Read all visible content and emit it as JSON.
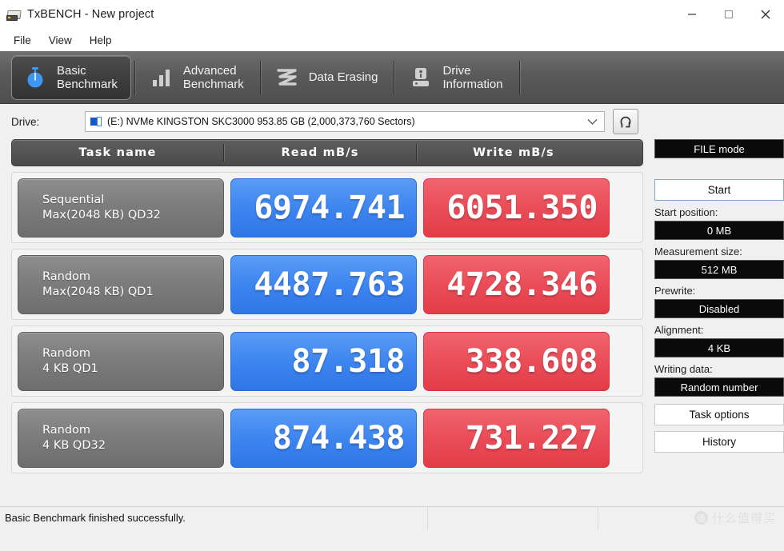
{
  "window": {
    "title": "TxBENCH - New project",
    "app_icon": "drive-icon",
    "minimize": "minimize-icon",
    "maximize": "maximize-icon",
    "close": "close-icon"
  },
  "menu": {
    "items": [
      {
        "label": "File"
      },
      {
        "label": "View"
      },
      {
        "label": "Help"
      }
    ]
  },
  "tabs": [
    {
      "label": "Basic\nBenchmark",
      "icon": "stopwatch-icon",
      "active": true
    },
    {
      "label": "Advanced\nBenchmark",
      "icon": "bar-chart-icon",
      "active": false
    },
    {
      "label": "Data Erasing",
      "icon": "eraser-wave-icon",
      "active": false
    },
    {
      "label": "Drive\nInformation",
      "icon": "drive-info-icon",
      "active": false
    }
  ],
  "drive": {
    "label": "Drive:",
    "value": "(E:) NVMe KINGSTON SKC3000  953.85 GB (2,000,373,760 Sectors)",
    "icon": "drive-icon",
    "dropdown_icon": "chevron-down-icon",
    "refresh_icon": "refresh-icon"
  },
  "table": {
    "headers": [
      "Task name",
      "Read mB/s",
      "Write mB/s"
    ],
    "rows": [
      {
        "task_line1": "Sequential",
        "task_line2": "Max(2048 KB) QD32",
        "read": "6974.741",
        "write": "6051.350"
      },
      {
        "task_line1": "Random",
        "task_line2": "Max(2048 KB) QD1",
        "read": "4487.763",
        "write": "4728.346"
      },
      {
        "task_line1": "Random",
        "task_line2": "4 KB QD1",
        "read": "87.318",
        "write": "338.608"
      },
      {
        "task_line1": "Random",
        "task_line2": "4 KB QD32",
        "read": "874.438",
        "write": "731.227"
      }
    ]
  },
  "sidebar": {
    "mode_button": "FILE mode",
    "start_button": "Start",
    "start_position_label": "Start position:",
    "start_position_value": "0 MB",
    "measurement_size_label": "Measurement size:",
    "measurement_size_value": "512 MB",
    "prewrite_label": "Prewrite:",
    "prewrite_value": "Disabled",
    "alignment_label": "Alignment:",
    "alignment_value": "4 KB",
    "writing_data_label": "Writing data:",
    "writing_data_value": "Random number",
    "task_options_button": "Task options",
    "history_button": "History"
  },
  "statusbar": {
    "message": "Basic Benchmark finished successfully.",
    "watermark_badge": "值",
    "watermark_text": "什么值得买"
  },
  "colors": {
    "read_badge": "#3d85f0",
    "write_badge": "#ea4d58",
    "tabstrip": "#5a5a5a",
    "header_row": "#4a4a4a",
    "task_cell": "#7b7b7b"
  }
}
